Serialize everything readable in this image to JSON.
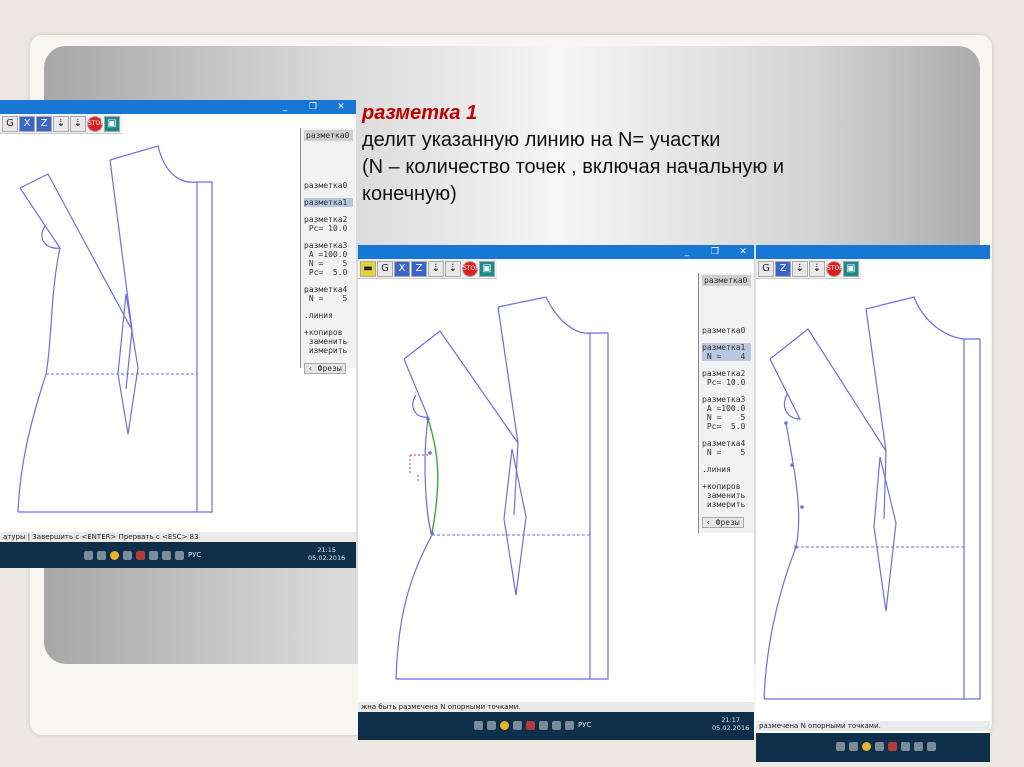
{
  "slide": {
    "title": "разметка 1",
    "line1": "делит указанную линию на N= участки",
    "line2": "(N – количество точек , включая начальную и",
    "line3": "конечную)"
  },
  "window_controls": {
    "minimize": "_",
    "maximize": "❐",
    "close": "✕"
  },
  "toolbar_icons": [
    "ruler-icon",
    "g-tool-icon",
    "x-tool-icon",
    "z-tool-icon",
    "down-arrow-icon",
    "down-arrow-icon",
    "stop-icon",
    "export-icon"
  ],
  "panel": {
    "m0": "разметка0",
    "m1": "разметка1",
    "m1_n": " N =    4",
    "m2": "разметка2",
    "m2_pc": " Pc= 10.0",
    "m3": "разметка3",
    "m3_a": " A =100.0",
    "m3_n": " N =    5",
    "m3_pc": " Pc=  5.0",
    "m4": "разметка4",
    "m4_n": " N =    5",
    "line": ".линия",
    "copy": "+копиров",
    "swap": " заменить",
    "measure": " измерить",
    "frames": "‹ Фрезы"
  },
  "screen1": {
    "status": "атуры | Завершить с <ENTER> Прервать с <ESC> 83",
    "lang": "РУС",
    "time": "21:15",
    "date": "05.02.2016"
  },
  "screen2": {
    "status": "жна быть размечена N опорными точками.",
    "lang": "РУС",
    "time": "21:17",
    "date": "05.02.2016"
  },
  "screen3": {
    "status": "размечена N опорными точками."
  },
  "colors": {
    "pattern_line": "#6d6ee0",
    "highlight_curve": "#3aa83a",
    "taskbar": "#0d2f4a",
    "titlebar": "#1877d4",
    "title_red": "#c00000"
  }
}
